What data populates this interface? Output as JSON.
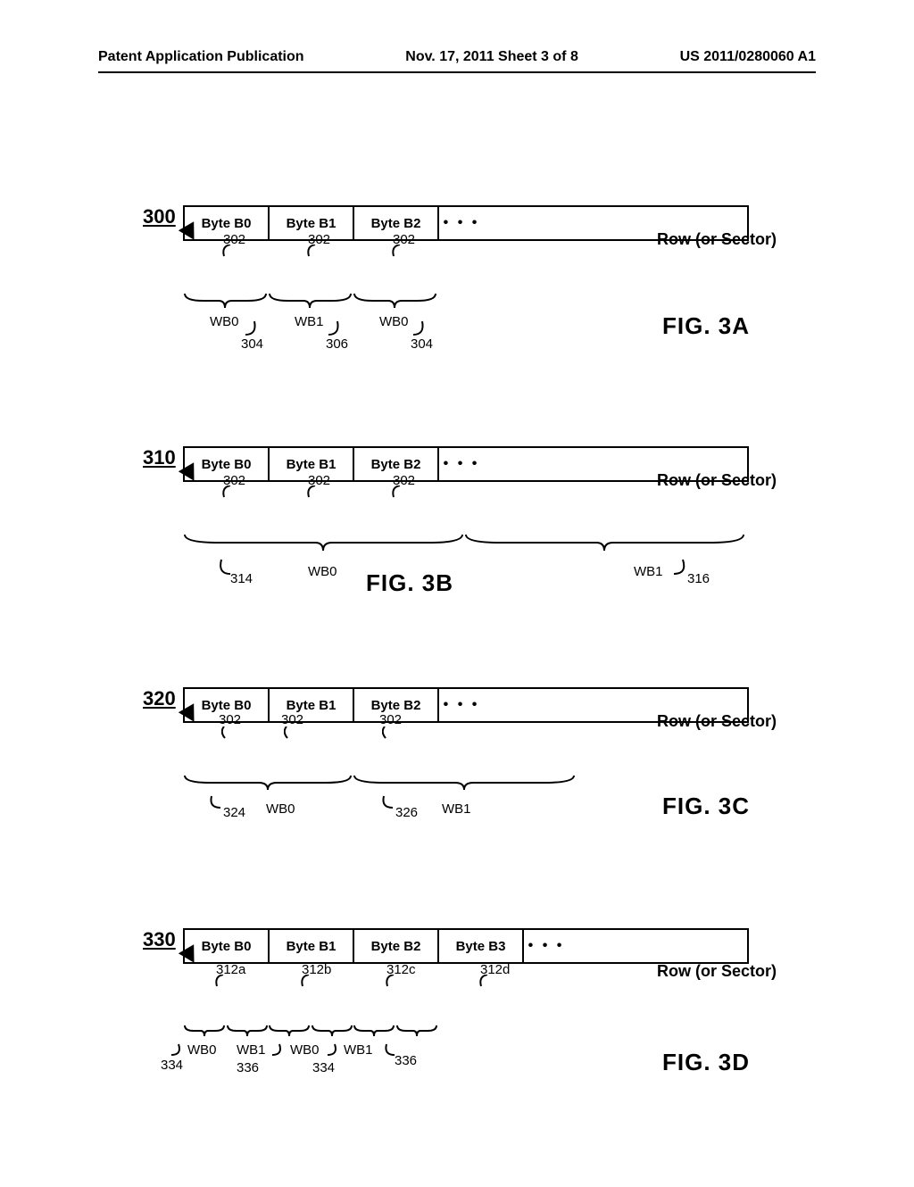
{
  "header": {
    "left": "Patent Application Publication",
    "center": "Nov. 17, 2011  Sheet 3 of 8",
    "right": "US 2011/0280060 A1"
  },
  "common": {
    "row_label": "Row (or Sector)",
    "ellipsis": "• • •"
  },
  "figA": {
    "tag": "300",
    "top_refs": [
      "302",
      "302",
      "302"
    ],
    "bytes": [
      "Byte B0",
      "Byte B1",
      "Byte B2"
    ],
    "braces": [
      {
        "label": "WB0",
        "ref": "304"
      },
      {
        "label": "WB1",
        "ref": "306"
      },
      {
        "label": "WB0",
        "ref": "304"
      }
    ],
    "title": "FIG.  3A"
  },
  "figB": {
    "tag": "310",
    "top_refs": [
      "302",
      "302",
      "302"
    ],
    "bytes": [
      "Byte B0",
      "Byte B1",
      "Byte B2"
    ],
    "braces": [
      {
        "label": "WB0",
        "ref": "314"
      },
      {
        "label": "WB1",
        "ref": "316"
      }
    ],
    "title": "FIG.  3B"
  },
  "figC": {
    "tag": "320",
    "top_refs": [
      "302",
      "302",
      "302"
    ],
    "bytes": [
      "Byte B0",
      "Byte B1",
      "Byte B2"
    ],
    "braces": [
      {
        "label": "WB0",
        "ref": "324"
      },
      {
        "label": "WB1",
        "ref": "326"
      }
    ],
    "title": "FIG.  3C"
  },
  "figD": {
    "tag": "330",
    "top_refs": [
      "312a",
      "312b",
      "312c",
      "312d"
    ],
    "bytes": [
      "Byte B0",
      "Byte B1",
      "Byte B2",
      "Byte B3"
    ],
    "braces": [
      {
        "label": "WB0",
        "ref": "334"
      },
      {
        "label": "WB1",
        "ref": "336"
      },
      {
        "label": "WB0",
        "ref": "334"
      },
      {
        "label": "WB1",
        "ref": "336"
      }
    ],
    "title": "FIG.  3D"
  }
}
